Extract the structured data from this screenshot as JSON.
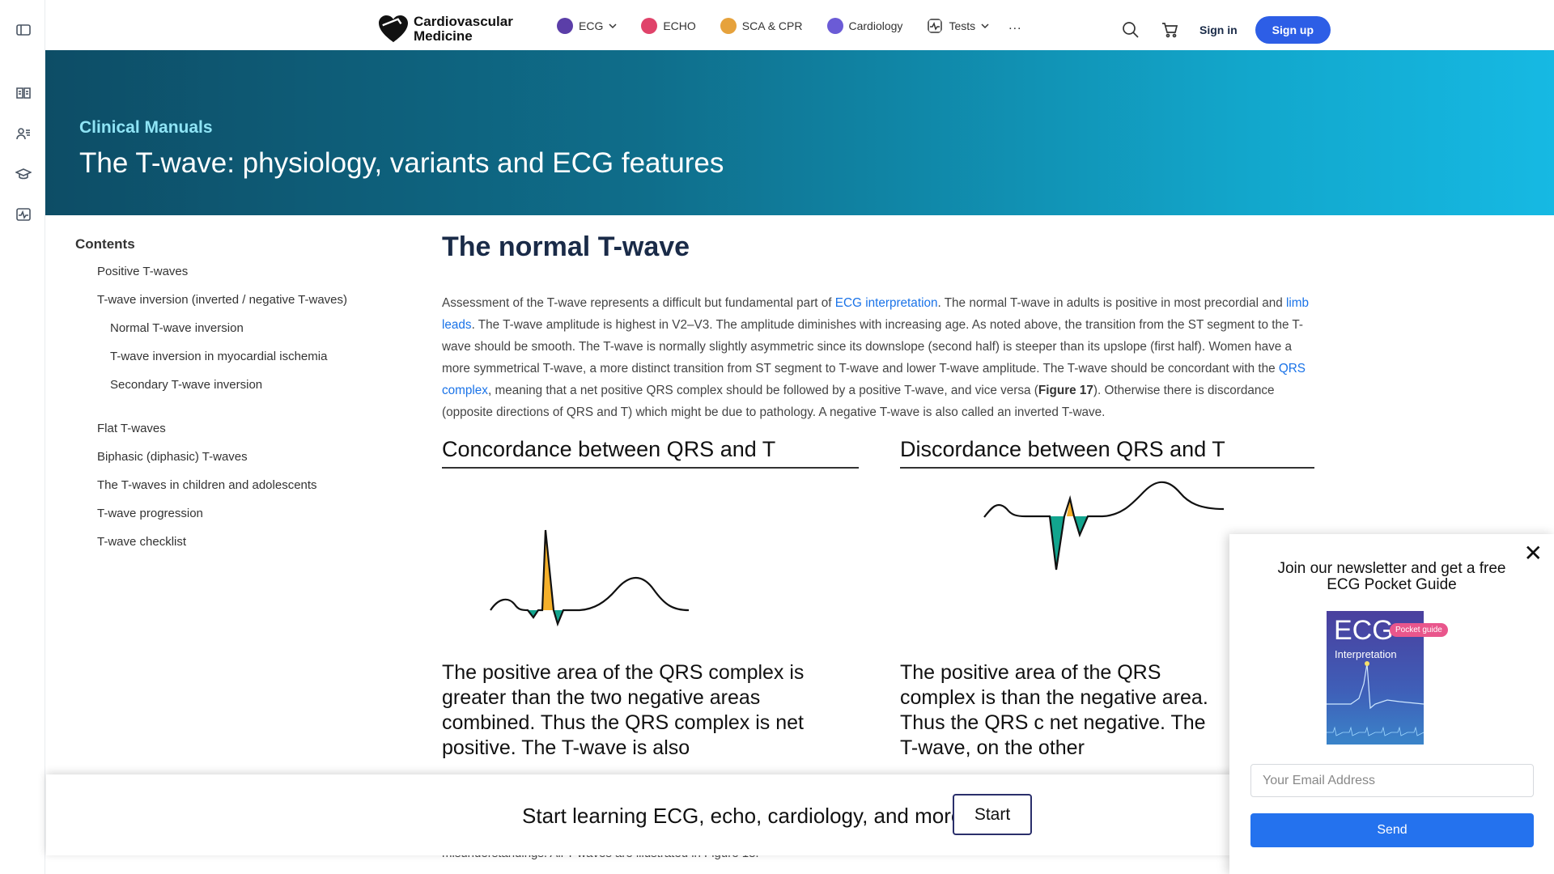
{
  "nav": {
    "logo_text": "Cardiovascular Medicine",
    "items": [
      {
        "label": "ECG",
        "icon": "ecg-heart-icon",
        "color": "#5b3ea8",
        "has_dropdown": true
      },
      {
        "label": "ECHO",
        "icon": "echo-heart-icon",
        "color": "#e0436a",
        "has_dropdown": false
      },
      {
        "label": "SCA & CPR",
        "icon": "shield-icon",
        "color": "#e6a23c",
        "has_dropdown": false
      },
      {
        "label": "Cardiology",
        "icon": "cardiology-heart-icon",
        "color": "#6b5bd6",
        "has_dropdown": false
      },
      {
        "label": "Tests",
        "icon": "pulse-icon",
        "color": "#333333",
        "has_dropdown": true
      }
    ],
    "more": "...",
    "signin": "Sign in",
    "signup": "Sign up"
  },
  "hero": {
    "kicker": "Clinical Manuals",
    "title": "The T-wave: physiology, variants and ECG features"
  },
  "toc": {
    "heading": "Contents",
    "items": [
      "Positive T-waves",
      "T-wave inversion (inverted / negative T-waves)",
      "Normal T-wave inversion",
      "T-wave inversion in myocardial ischemia",
      "Secondary T-wave inversion",
      "Flat T-waves",
      "Biphasic (diphasic) T-waves",
      "The T-waves in children and adolescents",
      "T-wave progression",
      "T-wave checklist"
    ]
  },
  "article": {
    "heading": "The normal T-wave",
    "p1": "Assessment of the T-wave represents a difficult but fundamental part of ",
    "link1": "ECG interpretation",
    "p2": ". The normal T-wave in adults is positive in most precordial and ",
    "link2": "limb leads",
    "p3": ". The T-wave amplitude is highest in V2–V3. The amplitude diminishes with increasing age. As noted above, the transition from the ST segment to the T-wave should be smooth. The T-wave is normally slightly asymmetric since its downslope (second half) is steeper than its upslope (first half). Women have a more symmetrical T-wave, a more distinct transition from ST segment to T-wave and lower T-wave amplitude. The T-wave should be concordant with the ",
    "link3": "QRS complex",
    "p4": ", meaning that a net positive QRS complex should be followed by a positive T-wave, and vice versa (",
    "fig_ref": "Figure 17",
    "p5": "). Otherwise there is discordance (opposite directions of QRS and T) which might be due to pathology. A negative T-wave is also called an inverted T-wave."
  },
  "figures": {
    "left_title": "Concordance between QRS and T",
    "left_caption": "The positive area of the QRS complex is greater than the two negative areas combined. Thus the QRS complex is net positive. The T-wave is also",
    "right_title": "Discordance between QRS and T",
    "right_caption": "The positive area of the QRS complex is than the negative area. Thus the QRS c net negative. The T-wave, on the other"
  },
  "banner": {
    "text": "Start learning ECG, echo, cardiology, and more",
    "button": "Start"
  },
  "below_text": "misunderstandings. All T-waves are illustrated in Figure 18.",
  "popup": {
    "title": "Join our newsletter and get a free ECG Pocket Guide",
    "book_title": "ECG",
    "book_badge": "Pocket guide",
    "book_subtitle": "Interpretation",
    "email_placeholder": "Your Email Address",
    "send": "Send",
    "close": "✕"
  },
  "colors": {
    "accent": "#2d5ee6",
    "positive_area": "#f5b02a",
    "negative_area": "#12a58e",
    "link": "#1a73e8"
  }
}
